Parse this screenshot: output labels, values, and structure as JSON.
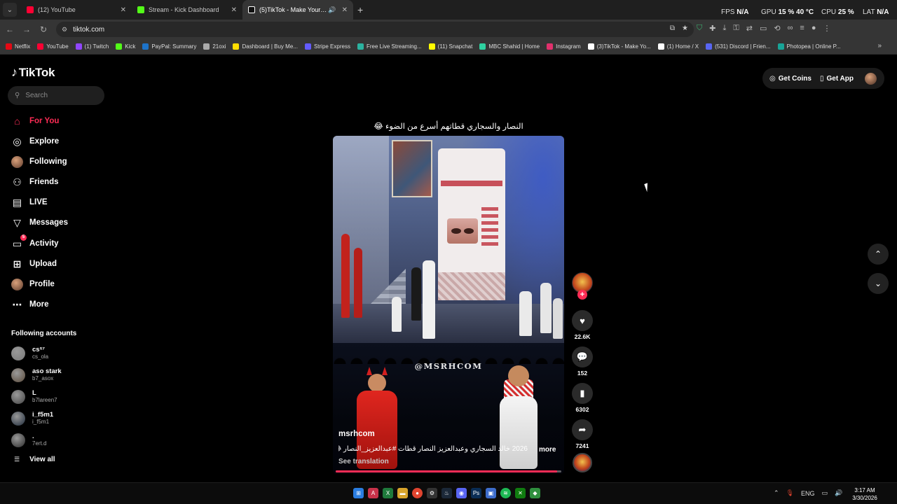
{
  "browser": {
    "tabs": [
      {
        "title": "(12) YouTube",
        "color": "#ff0033",
        "active": false
      },
      {
        "title": "Stream - Kick Dashboard",
        "color": "#53fc18",
        "active": false
      },
      {
        "title": "(5)TikTok - Make Your Day",
        "color": "#ffffff",
        "active": true
      }
    ],
    "hud": {
      "fps_label": "FPS",
      "fps_value": "N/A",
      "gpu_label": "GPU",
      "gpu_value": "15 % 40 °C",
      "cpu_label": "CPU",
      "cpu_value": "25 %",
      "lat_label": "LAT",
      "lat_value": "N/A"
    },
    "url": "tiktok.com",
    "bookmarks": [
      {
        "label": "Netflix",
        "color": "#e50914"
      },
      {
        "label": "YouTube",
        "color": "#ff0033"
      },
      {
        "label": "(1) Twitch",
        "color": "#9146ff"
      },
      {
        "label": "Kick",
        "color": "#53fc18"
      },
      {
        "label": "PayPal: Summary",
        "color": "#1d73c9"
      },
      {
        "label": "21oxi",
        "color": "#aaaaaa"
      },
      {
        "label": "Dashboard | Buy Me...",
        "color": "#ffdd00"
      },
      {
        "label": "Stripe Express",
        "color": "#635bff"
      },
      {
        "label": "Free Live Streaming...",
        "color": "#2bb3a0"
      },
      {
        "label": "(11) Snapchat",
        "color": "#fffc00"
      },
      {
        "label": "MBC Shahid | Home",
        "color": "#2ed1a0"
      },
      {
        "label": "Instagram",
        "color": "#e1306c"
      },
      {
        "label": "(3)TikTok - Make Yo...",
        "color": "#ffffff"
      },
      {
        "label": "(1) Home / X",
        "color": "#ffffff"
      },
      {
        "label": "(531) Discord | Frien...",
        "color": "#5865f2"
      },
      {
        "label": "Photopea | Online P...",
        "color": "#18a497"
      }
    ]
  },
  "tiktok": {
    "brand": "TikTok",
    "search_placeholder": "Search",
    "nav": [
      {
        "label": "For You",
        "icon": "home-icon"
      },
      {
        "label": "Explore",
        "icon": "compass-icon"
      },
      {
        "label": "Following",
        "icon": "avatar-icon"
      },
      {
        "label": "Friends",
        "icon": "friends-icon"
      },
      {
        "label": "LIVE",
        "icon": "live-icon"
      },
      {
        "label": "Messages",
        "icon": "messages-icon"
      },
      {
        "label": "Activity",
        "icon": "activity-icon",
        "badge": "5"
      },
      {
        "label": "Upload",
        "icon": "upload-icon"
      },
      {
        "label": "Profile",
        "icon": "profile-icon"
      },
      {
        "label": "More",
        "icon": "more-icon"
      }
    ],
    "following_title": "Following accounts",
    "following": [
      {
        "name": "csˢ⁷",
        "handle": "cs_ola"
      },
      {
        "name": "aso stark",
        "handle": "b7_asox"
      },
      {
        "name": "L",
        "handle": "b7lareen7"
      },
      {
        "name": "i_f5m1",
        "handle": "i_f5m1"
      },
      {
        "name": ".",
        "handle": "7ert.d"
      }
    ],
    "view_all": "View all",
    "get_coins": "Get Coins",
    "get_app": "Get App",
    "caption": "النصار والسجاري قطاتهم أسرع من الضوء 😂",
    "video": {
      "watermark": "@MSRHCOM",
      "username": "msrhcom",
      "description": "2026 خالد السجاري وعبدالعزيز النصار قطات #عبدالعزيز_النصار 😂 ...",
      "more": "more",
      "see_translation": "See translation",
      "progress": 0.98
    },
    "actions": {
      "likes": "22.6K",
      "comments": "152",
      "saves": "6302",
      "shares": "7241"
    }
  },
  "taskbar": {
    "lang": "ENG",
    "time": "3:17 AM",
    "date": "3/30/2026"
  }
}
